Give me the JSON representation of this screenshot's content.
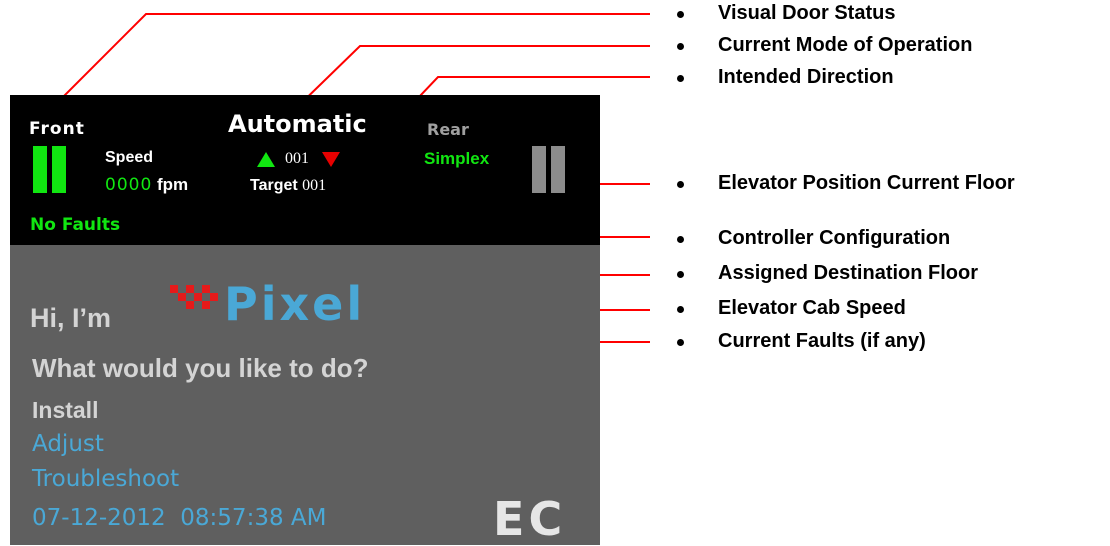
{
  "screen": {
    "front_label": "Front",
    "mode": "Automatic",
    "rear_label": "Rear",
    "speed_label": "Speed",
    "speed_value": "0000",
    "speed_unit": "fpm",
    "current_floor": "001",
    "target_label": "Target",
    "target_floor": "001",
    "configuration": "Simplex",
    "faults": "No Faults",
    "greeting": "Hi, I’m",
    "brand": "Pixel",
    "prompt": "What would you like to do?",
    "menu": [
      "Install",
      "Adjust",
      "Troubleshoot"
    ],
    "datetime": "07-12-2012  08:57:38 AM",
    "logo": "E C",
    "colors": {
      "status_bar": "#000000",
      "screen": "#5f5f5f",
      "door_front": "#11e611",
      "door_rear": "#8c8c8c",
      "up_arrow": "#11e611",
      "down_arrow": "#e60000",
      "accent": "#4aa8d6",
      "leader_line": "#ff0000"
    }
  },
  "callouts": [
    "Visual Door Status",
    "Current Mode of Operation",
    "Intended Direction",
    "Elevator Position Current Floor",
    "Controller Configuration",
    "Assigned Destination Floor",
    "Elevator Cab Speed",
    "Current Faults (if any)"
  ]
}
